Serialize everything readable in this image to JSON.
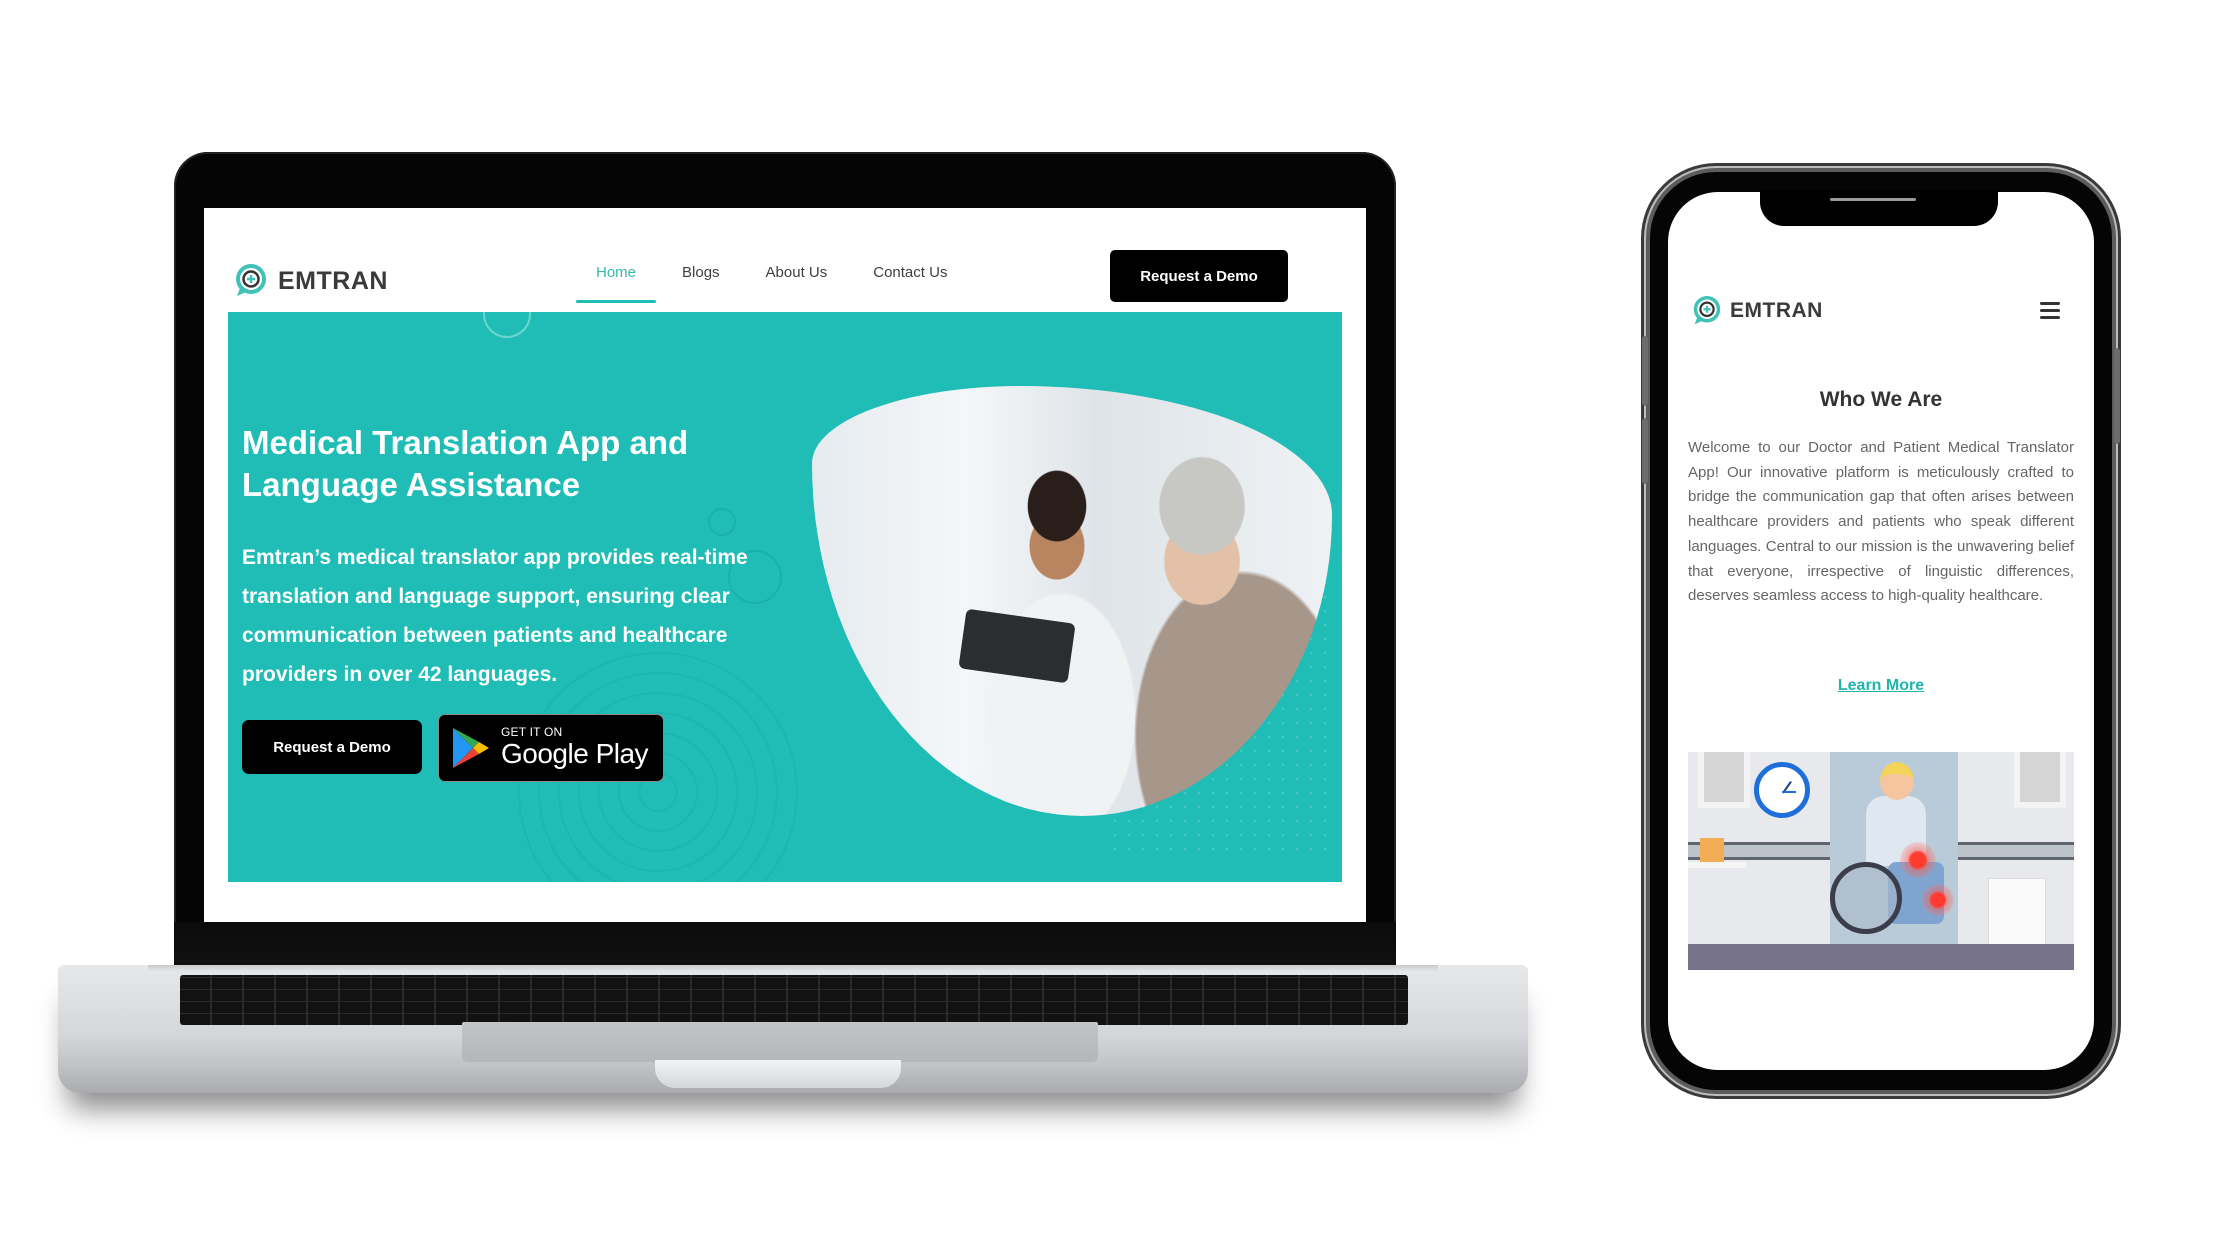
{
  "laptop": {
    "brand": {
      "name": "EMTRAN",
      "logo_icon": "chat-bubble-medical-cross-icon"
    },
    "nav": [
      {
        "label": "Home",
        "active": true
      },
      {
        "label": "Blogs",
        "active": false
      },
      {
        "label": "About Us",
        "active": false
      },
      {
        "label": "Contact Us",
        "active": false
      }
    ],
    "header_cta": "Request a Demo",
    "hero": {
      "title": "Medical Translation App and Language Assistance",
      "description": "Emtran’s medical translator app provides real-time translation and language support, ensuring clear communication between patients and healthcare providers in over 42 languages.",
      "demo_button": "Request a Demo",
      "store_badge": {
        "small": "GET IT ON",
        "big": "Google Play",
        "icon": "google-play-icon"
      },
      "image_alt": "Doctor with tablet talking to elderly patient"
    }
  },
  "phone": {
    "brand": {
      "name": "EMTRAN",
      "logo_icon": "chat-bubble-medical-cross-icon"
    },
    "menu_icon": "hamburger-menu-icon",
    "section_title": "Who We Are",
    "body": "Welcome to our Doctor and Patient Medical Translator App! Our innovative platform is meticulously crafted to bridge the communication gap that often arises between healthcare providers and patients who speak different languages. Central to our mission is the unwavering belief that everyone, irrespective of linguistic differences, deserves seamless access to high-quality healthcare.",
    "link": "Learn More",
    "image_alt": "Illustration of patient in wheelchair in hospital corridor"
  },
  "colors": {
    "brand_teal": "#1fbdb5",
    "link_teal": "#1fb5ac",
    "button_black": "#000000",
    "heading_dark": "#333333"
  }
}
